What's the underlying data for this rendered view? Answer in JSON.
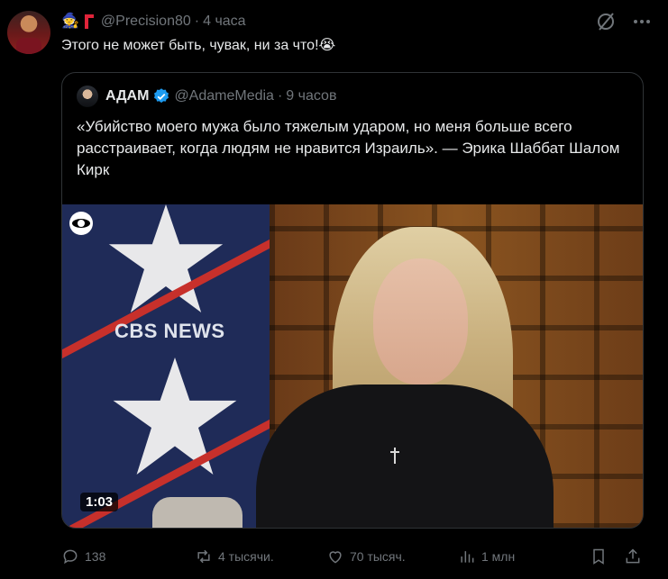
{
  "tweet": {
    "handle": "@Precision80",
    "separator": "·",
    "time": "4 часа",
    "badge_emoji": "🧙",
    "text": "Этого не может быть, чувак, ни за что!😭"
  },
  "quote": {
    "name": "АДАМ",
    "handle": "@AdameMedia",
    "separator": "·",
    "time": "9 часов",
    "text": "«Убийство моего мужа было тяжелым ударом, но меня больше всего расстраивает, когда людям не нравится Израиль». — Эрика Шаббат Шалом Кирк",
    "media": {
      "watermark": "CBS NEWS",
      "duration": "1:03"
    }
  },
  "actions": {
    "replies": "138",
    "reposts": "4 тысячи.",
    "likes": "70 тысяч.",
    "views": "1 млн"
  },
  "colors": {
    "background": "#000000",
    "text_primary": "#e7e9ea",
    "text_secondary": "#71767b",
    "verified": "#1d9bf0",
    "border": "#2f3336"
  }
}
